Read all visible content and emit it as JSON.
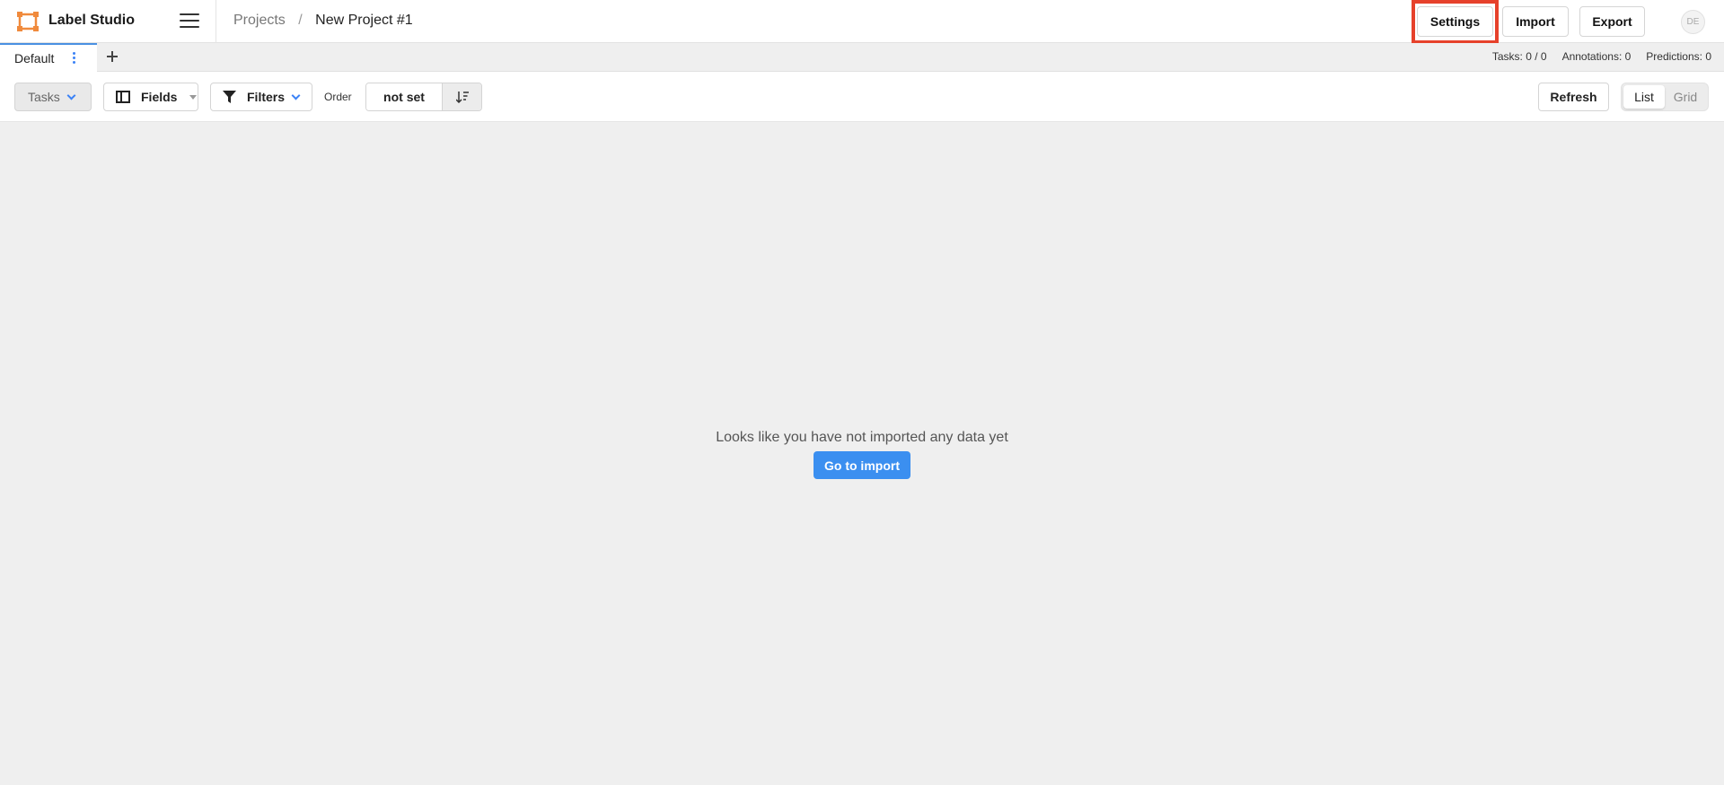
{
  "header": {
    "app_name": "Label Studio",
    "breadcrumb": {
      "root": "Projects",
      "separator": "/",
      "current": "New Project #1"
    },
    "buttons": {
      "settings": "Settings",
      "import": "Import",
      "export": "Export"
    },
    "avatar_initials": "DE"
  },
  "tabs": {
    "items": [
      {
        "label": "Default",
        "active": true
      }
    ],
    "add_icon": "plus-icon"
  },
  "stats": {
    "tasks": "Tasks: 0 / 0",
    "annotations": "Annotations: 0",
    "predictions": "Predictions: 0"
  },
  "toolbar": {
    "tasks_label": "Tasks",
    "fields_label": "Fields",
    "filters_label": "Filters",
    "order_label": "Order",
    "order_value": "not set",
    "refresh_label": "Refresh",
    "view_options": [
      {
        "label": "List",
        "active": true
      },
      {
        "label": "Grid",
        "active": false
      }
    ]
  },
  "empty_state": {
    "message": "Looks like you have not imported any data yet",
    "button": "Go to import"
  },
  "colors": {
    "accent": "#3b8ff0",
    "highlight": "#e6412b",
    "logo": "#f08a3c"
  }
}
